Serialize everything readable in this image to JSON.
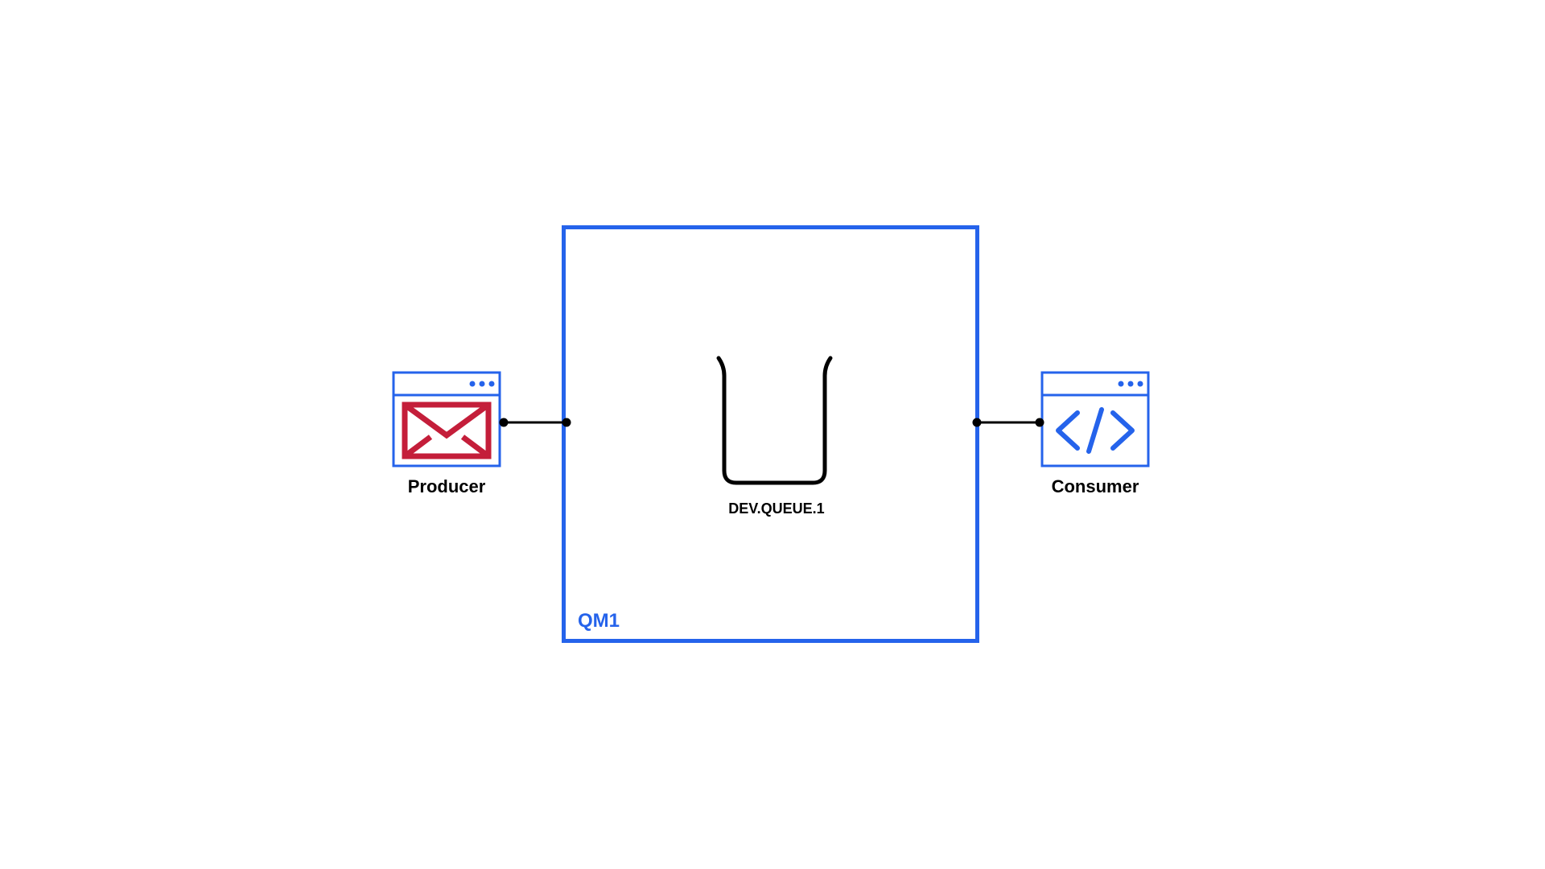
{
  "diagram": {
    "queueManager": {
      "label": "QM1"
    },
    "queue": {
      "label": "DEV.QUEUE.1"
    },
    "producer": {
      "label": "Producer"
    },
    "consumer": {
      "label": "Consumer"
    },
    "colors": {
      "blue": "#2563eb",
      "red": "#c41e3a",
      "black": "#000000"
    }
  }
}
